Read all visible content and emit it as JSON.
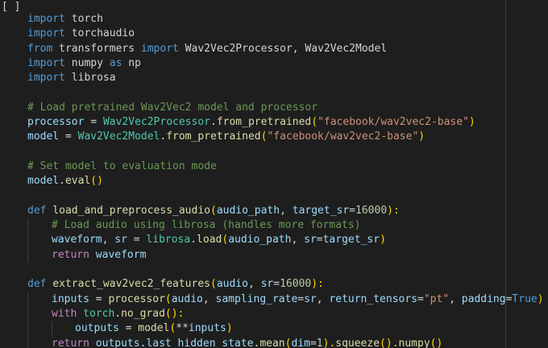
{
  "cell_marker": "[ ]",
  "colors": {
    "background": "#1e1e1e",
    "keyword": "#569cd6",
    "control": "#c586c0",
    "function": "#dcdcaa",
    "class": "#4ec9b0",
    "string": "#ce9178",
    "number": "#b5cea8",
    "comment": "#6a9955",
    "param": "#9cdcfe",
    "text": "#d4d4d4"
  },
  "code": {
    "l1": {
      "t1": "import",
      "t2": " torch"
    },
    "l2": {
      "t1": "import",
      "t2": " torchaudio"
    },
    "l3": {
      "t1": "from",
      "t2": " transformers ",
      "t3": "import",
      "t4": " Wav2Vec2Processor, Wav2Vec2Model"
    },
    "l4": {
      "t1": "import",
      "t2": " numpy ",
      "t3": "as",
      "t4": " np"
    },
    "l5": {
      "t1": "import",
      "t2": " librosa"
    },
    "l7": {
      "t1": "# Load pretrained Wav2Vec2 model and processor"
    },
    "l8": {
      "t1": "processor",
      "t2": " = ",
      "t3": "Wav2Vec2Processor",
      "t4": ".",
      "t5": "from_pretrained",
      "t6": "(",
      "t7": "\"facebook/wav2vec2-base\"",
      "t8": ")"
    },
    "l9": {
      "t1": "model",
      "t2": " = ",
      "t3": "Wav2Vec2Model",
      "t4": ".",
      "t5": "from_pretrained",
      "t6": "(",
      "t7": "\"facebook/wav2vec2-base\"",
      "t8": ")"
    },
    "l11": {
      "t1": "# Set model to evaluation mode"
    },
    "l12": {
      "t1": "model",
      "t2": ".",
      "t3": "eval",
      "t4": "()"
    },
    "l14": {
      "t1": "def",
      "t2": " ",
      "t3": "load_and_preprocess_audio",
      "t4": "(",
      "t5": "audio_path",
      "t6": ", ",
      "t7": "target_sr",
      "t8": "=",
      "t9": "16000",
      "t10": "):"
    },
    "l15": {
      "t1": "# Load audio using librosa (handles more formats)"
    },
    "l16": {
      "t1": "waveform",
      "t2": ", ",
      "t3": "sr",
      "t4": " = ",
      "t5": "librosa",
      "t6": ".",
      "t7": "load",
      "t8": "(",
      "t9": "audio_path",
      "t10": ", ",
      "t11": "sr",
      "t12": "=",
      "t13": "target_sr",
      "t14": ")"
    },
    "l17": {
      "t1": "return",
      "t2": " ",
      "t3": "waveform"
    },
    "l19": {
      "t1": "def",
      "t2": " ",
      "t3": "extract_wav2vec2_features",
      "t4": "(",
      "t5": "audio",
      "t6": ", ",
      "t7": "sr",
      "t8": "=",
      "t9": "16000",
      "t10": "):"
    },
    "l20": {
      "t1": "inputs",
      "t2": " = ",
      "t3": "processor",
      "t4": "(",
      "t5": "audio",
      "t6": ", ",
      "t7": "sampling_rate",
      "t8": "=",
      "t9": "sr",
      "t10": ", ",
      "t11": "return_tensors",
      "t12": "=",
      "t13": "\"pt\"",
      "t14": ", ",
      "t15": "padding",
      "t16": "=",
      "t17": "True",
      "t18": ")"
    },
    "l21": {
      "t1": "with",
      "t2": " ",
      "t3": "torch",
      "t4": ".",
      "t5": "no_grad",
      "t6": "():"
    },
    "l22": {
      "t1": "outputs",
      "t2": " = ",
      "t3": "model",
      "t4": "(",
      "t5": "**",
      "t6": "inputs",
      "t7": ")"
    },
    "l23": {
      "t1": "return",
      "t2": " ",
      "t3": "outputs",
      "t4": ".",
      "t5": "last_hidden_state",
      "t6": ".",
      "t7": "mean",
      "t8": "(",
      "t9": "dim",
      "t10": "=",
      "t11": "1",
      "t12": ").",
      "t13": "squeeze",
      "t14": "().",
      "t15": "numpy",
      "t16": "()"
    }
  }
}
